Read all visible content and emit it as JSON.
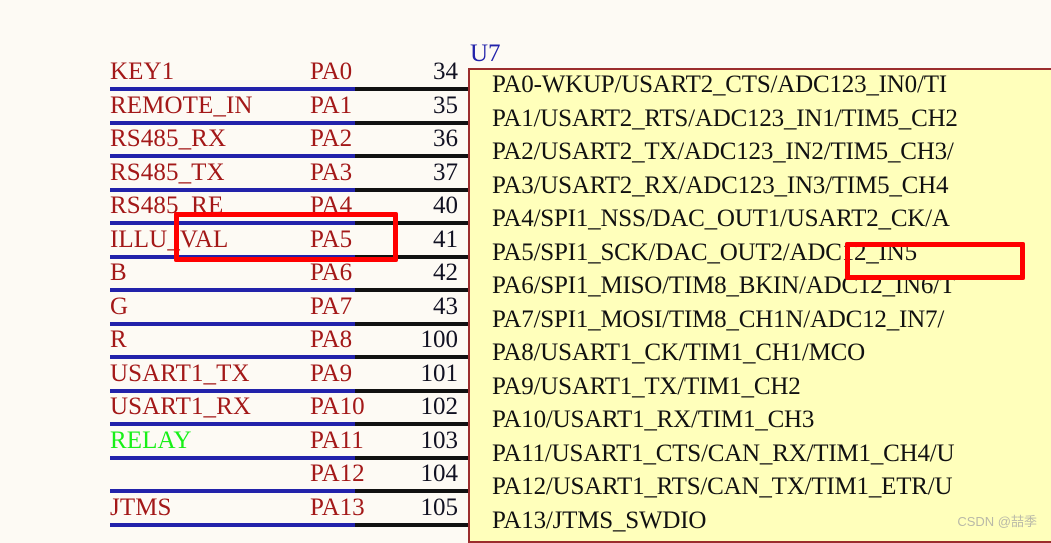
{
  "sheet": {
    "background_color": "#fdfaf4",
    "net_label_color": "#a31818",
    "pin_number_color": "#111122",
    "wire_color": "#2222aa",
    "pin_stub_color": "#111111",
    "highlight_color": "#ff0000"
  },
  "component": {
    "refdes": "U7",
    "refdes_color": "#2222aa",
    "body_fill": "#ffffbb",
    "body_border": "#9b2d2d"
  },
  "pins": [
    {
      "net": "KEY1",
      "pin": "PA0",
      "number": "34",
      "function": "PA0-WKUP/USART2_CTS/ADC123_IN0/TI",
      "net_color": "#a31818"
    },
    {
      "net": "REMOTE_IN",
      "pin": "PA1",
      "number": "35",
      "function": "PA1/USART2_RTS/ADC123_IN1/TIM5_CH2",
      "net_color": "#a31818"
    },
    {
      "net": "RS485_RX",
      "pin": "PA2",
      "number": "36",
      "function": "PA2/USART2_TX/ADC123_IN2/TIM5_CH3/",
      "net_color": "#a31818"
    },
    {
      "net": "RS485_TX",
      "pin": "PA3",
      "number": "37",
      "function": "PA3/USART2_RX/ADC123_IN3/TIM5_CH4",
      "net_color": "#a31818"
    },
    {
      "net": "RS485_RE",
      "pin": "PA4",
      "number": "40",
      "function": "PA4/SPI1_NSS/DAC_OUT1/USART2_CK/A",
      "net_color": "#a31818"
    },
    {
      "net": "ILLU_VAL",
      "pin": "PA5",
      "number": "41",
      "function": "PA5/SPI1_SCK/DAC_OUT2/ADC12_IN5",
      "net_color": "#a31818"
    },
    {
      "net": "B",
      "pin": "PA6",
      "number": "42",
      "function": "PA6/SPI1_MISO/TIM8_BKIN/ADC12_IN6/T",
      "net_color": "#a31818"
    },
    {
      "net": "G",
      "pin": "PA7",
      "number": "43",
      "function": "PA7/SPI1_MOSI/TIM8_CH1N/ADC12_IN7/",
      "net_color": "#a31818"
    },
    {
      "net": "R",
      "pin": "PA8",
      "number": "100",
      "function": "PA8/USART1_CK/TIM1_CH1/MCO",
      "net_color": "#a31818"
    },
    {
      "net": "USART1_TX",
      "pin": "PA9",
      "number": "101",
      "function": "PA9/USART1_TX/TIM1_CH2",
      "net_color": "#a31818"
    },
    {
      "net": "USART1_RX",
      "pin": "PA10",
      "number": "102",
      "function": "PA10/USART1_RX/TIM1_CH3",
      "net_color": "#a31818"
    },
    {
      "net": "RELAY",
      "pin": "PA11",
      "number": "103",
      "function": "PA11/USART1_CTS/CAN_RX/TIM1_CH4/U",
      "net_color": "#18f018"
    },
    {
      "net": "",
      "pin": "PA12",
      "number": "104",
      "function": "PA12/USART1_RTS/CAN_TX/TIM1_ETR/U",
      "net_color": "#a31818"
    },
    {
      "net": "JTMS",
      "pin": "PA13",
      "number": "105",
      "function": "PA13/JTMS_SWDIO",
      "net_color": "#a31818"
    }
  ],
  "highlights": [
    {
      "name": "highlight-illu-val-pa5",
      "target": "ILLU_VAL / PA5 row"
    },
    {
      "name": "highlight-adc12-in5",
      "target": "ADC12_IN5"
    }
  ],
  "watermark": {
    "text": "CSDN @喆季"
  }
}
